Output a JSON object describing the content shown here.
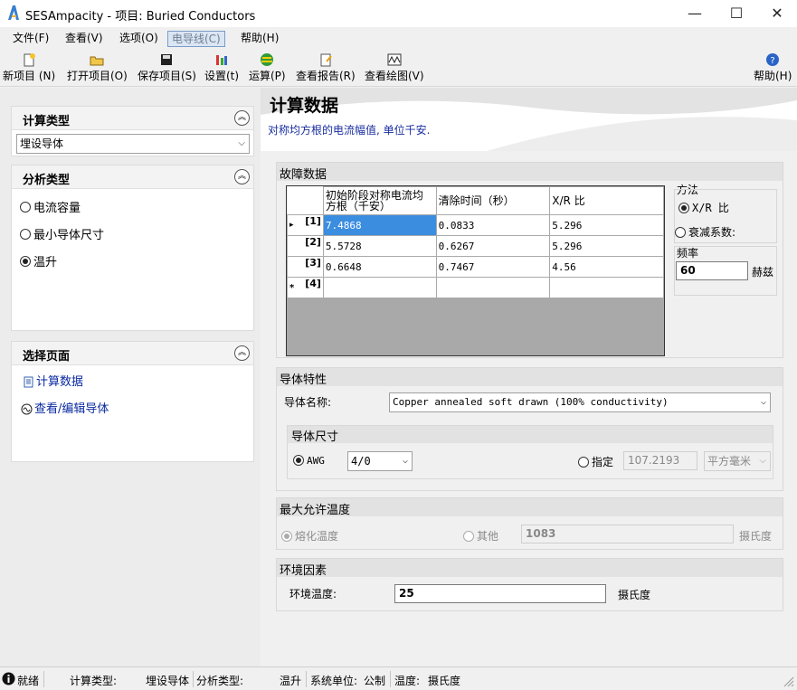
{
  "window": {
    "title": "SESAmpacity - 项目: Buried Conductors",
    "minimize": "—",
    "maximize": "☐",
    "close": "✕"
  },
  "menu": [
    "文件(F)",
    "查看(V)",
    "选项(O)",
    "电导线(C)",
    "帮助(H)"
  ],
  "toolbar": {
    "new": "新项目 (N)",
    "open": "打开项目(O)",
    "save": "保存项目(S)",
    "settings": "设置(t)",
    "run": "运算(P)",
    "report": "查看报告(R)",
    "plot": "查看绘图(V)",
    "help": "帮助(H)"
  },
  "left": {
    "calc_type": {
      "title": "计算类型",
      "value": "埋设导体"
    },
    "analysis_type": {
      "title": "分析类型",
      "options": [
        "电流容量",
        "最小导体尺寸",
        "温升"
      ],
      "selected": 2
    },
    "pages": {
      "title": "选择页面",
      "items": [
        "计算数据",
        "查看/编辑导体"
      ]
    }
  },
  "banner": {
    "title": "计算数据",
    "subtitle": "对称均方根的电流幅值, 单位千安."
  },
  "fault": {
    "title": "故障数据",
    "columns": [
      "初始阶段对称电流均方根（千安）",
      "清除时间（秒）",
      "X/R 比"
    ],
    "rows": [
      {
        "id": "[1]",
        "marker": "▸",
        "current": "7.4868",
        "time": "0.0833",
        "xr": "5.296"
      },
      {
        "id": "[2]",
        "marker": "",
        "current": "5.5728",
        "time": "0.6267",
        "xr": "5.296"
      },
      {
        "id": "[3]",
        "marker": "",
        "current": "0.6648",
        "time": "0.7467",
        "xr": "4.56"
      },
      {
        "id": "[4]",
        "marker": "*",
        "current": "",
        "time": "",
        "xr": ""
      }
    ],
    "method": {
      "title": "方法",
      "opt1": "X/R 比",
      "opt2": "衰减系数:"
    },
    "freq": {
      "title": "频率",
      "value": "60",
      "unit": "赫兹"
    }
  },
  "conductor": {
    "title": "导体特性",
    "name_label": "导体名称:",
    "name_value": "Copper annealed soft drawn (100% conductivity)",
    "size": {
      "title": "导体尺寸",
      "awg_label": "AWG",
      "awg_value": "4/0",
      "specify_label": "指定",
      "specify_value": "107.2193",
      "unit": "平方毫米"
    }
  },
  "maxtemp": {
    "title": "最大允许温度",
    "opt1": "熔化温度",
    "opt2": "其他",
    "value": "1083",
    "unit": "摄氏度"
  },
  "env": {
    "title": "环境因素",
    "label": "环境温度:",
    "value": "25",
    "unit": "摄氏度"
  },
  "status": {
    "ready": "就绪",
    "calc_label": "计算类型:",
    "calc_value": "埋设导体",
    "analysis_label": "分析类型:",
    "analysis_value": "温升",
    "units_label": "系统单位:",
    "units_value": "公制",
    "temp_label": "温度:",
    "temp_value": "摄氏度"
  }
}
